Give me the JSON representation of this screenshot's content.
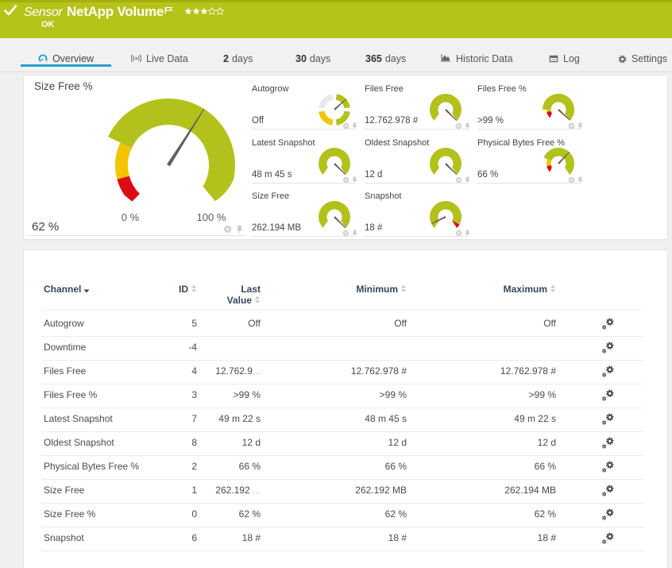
{
  "window": {
    "status_icon": "check",
    "kind": "Sensor",
    "title": "NetApp Volume",
    "status": "OK",
    "rating": {
      "filled": 3,
      "total": 5
    },
    "colors": {
      "header_green": "#b6c318",
      "gauge_green": "#b3c11c",
      "warn_yellow": "#f2c500",
      "error_red": "#dd0b15",
      "accent_blue": "#2aa0cb"
    }
  },
  "tabs": [
    {
      "id": "overview",
      "icon": "gauge-icon",
      "label": "Overview",
      "active": true
    },
    {
      "id": "live-data",
      "icon": "broadcast-icon",
      "label": "Live Data",
      "active": false
    },
    {
      "id": "2-days",
      "num": "2",
      "label": "days",
      "active": false
    },
    {
      "id": "30-days",
      "num": "30",
      "label": "days",
      "active": false
    },
    {
      "id": "365-days",
      "num": "365",
      "label": "days",
      "active": false
    },
    {
      "id": "historic-data",
      "icon": "area-chart-icon",
      "label": "Historic Data",
      "active": false
    },
    {
      "id": "log",
      "icon": "log-icon",
      "label": "Log",
      "active": false
    },
    {
      "id": "settings",
      "icon": "gear-icon",
      "label": "Settings",
      "active": false
    }
  ],
  "overview": {
    "main_gauge": {
      "title": "Size Free %",
      "value": "62 %",
      "min_label": "0 %",
      "max_label": "100 %",
      "needle": 0.62,
      "segments": [
        {
          "from": 0,
          "to": 0.11,
          "color": "red",
          "thin": true
        },
        {
          "from": 0.11,
          "to": 0.26,
          "color": "yellow",
          "thin": true
        },
        {
          "from": 0.26,
          "to": 1,
          "color": "green",
          "thin": false
        }
      ]
    },
    "gauges": [
      {
        "label": "Autogrow",
        "value": "Off",
        "type": "donut",
        "needle_angle": 42,
        "donut_segments": [
          {
            "a0": 8,
            "a1": 82,
            "color": "green"
          },
          {
            "a0": 98,
            "a1": 172,
            "color": "green"
          },
          {
            "a0": 188,
            "a1": 262,
            "color": "yellow"
          },
          {
            "a0": 278,
            "a1": 352,
            "color": "gray"
          }
        ]
      },
      {
        "label": "Files Free",
        "value": "12.762.978 #",
        "type": "gauge",
        "needle": 1,
        "segments": [
          {
            "from": 0,
            "to": 1,
            "color": "green",
            "thin": false
          }
        ]
      },
      {
        "label": "Files Free %",
        "value": ">99 %",
        "type": "gauge",
        "needle": 0.99,
        "segments": [
          {
            "from": 0,
            "to": 0.125,
            "color": "red",
            "thin": true
          },
          {
            "from": 0.125,
            "to": 0.168,
            "color": "yellow",
            "thin": true
          },
          {
            "from": 0.168,
            "to": 1,
            "color": "green",
            "thin": false
          }
        ]
      },
      {
        "label": "Latest Snapshot",
        "value": "48 m 45 s",
        "type": "gauge",
        "needle": 1,
        "segments": [
          {
            "from": 0,
            "to": 1,
            "color": "green",
            "thin": false
          }
        ]
      },
      {
        "label": "Oldest Snapshot",
        "value": "12 d",
        "type": "gauge",
        "needle": 1,
        "segments": [
          {
            "from": 0,
            "to": 1,
            "color": "green",
            "thin": false
          }
        ]
      },
      {
        "label": "Physical Bytes Free %",
        "value": "66 %",
        "type": "gauge",
        "needle": 0.66,
        "segments": [
          {
            "from": 0,
            "to": 0.125,
            "color": "red",
            "thin": true
          },
          {
            "from": 0.125,
            "to": 0.25,
            "color": "yellow",
            "thin": true
          },
          {
            "from": 0.25,
            "to": 1,
            "color": "green",
            "thin": false
          }
        ]
      },
      {
        "label": "Size Free",
        "value": "262.194 MB",
        "type": "gauge",
        "needle": 1,
        "segments": [
          {
            "from": 0,
            "to": 1,
            "color": "green",
            "thin": false
          }
        ]
      },
      {
        "label": "Snapshot",
        "value": "18 #",
        "type": "gauge",
        "needle": 0.072,
        "segments": [
          {
            "from": 0,
            "to": 0.94,
            "color": "green",
            "thin": false
          },
          {
            "from": 0.94,
            "to": 1,
            "color": "red",
            "thin": false
          }
        ]
      }
    ]
  },
  "table": {
    "columns": [
      {
        "id": "channel",
        "label": "Channel",
        "sort": "active"
      },
      {
        "id": "id",
        "label": "ID",
        "sort": "both"
      },
      {
        "id": "last",
        "label": "Last Value",
        "label_line1": "Last",
        "label_line2": "Value",
        "sort": "both"
      },
      {
        "id": "min",
        "label": "Minimum",
        "sort": "both"
      },
      {
        "id": "max",
        "label": "Maximum",
        "sort": "both"
      }
    ],
    "rows": [
      {
        "name": "Autogrow",
        "id": "5",
        "last": "Off",
        "min": "Off",
        "max": "Off"
      },
      {
        "name": "Downtime",
        "id": "-4",
        "last": "",
        "min": "",
        "max": ""
      },
      {
        "name": "Files Free",
        "id": "4",
        "last": "12.762.9",
        "last_trunc": "...",
        "min": "12.762.978 #",
        "max": "12.762.978 #"
      },
      {
        "name": "Files Free %",
        "id": "3",
        "last": ">99 %",
        "min": ">99 %",
        "max": ">99 %"
      },
      {
        "name": "Latest Snapshot",
        "id": "7",
        "last": "49 m 22 s",
        "min": "48 m 45 s",
        "max": "49 m 22 s"
      },
      {
        "name": "Oldest Snapshot",
        "id": "8",
        "last": "12 d",
        "min": "12 d",
        "max": "12 d"
      },
      {
        "name": "Physical Bytes Free %",
        "id": "2",
        "last": "66 %",
        "min": "66 %",
        "max": "66 %"
      },
      {
        "name": "Size Free",
        "id": "1",
        "last": "262.192 ",
        "last_trunc": "...",
        "min": "262.192 MB",
        "max": "262.194 MB"
      },
      {
        "name": "Size Free %",
        "id": "0",
        "last": "62 %",
        "min": "62 %",
        "max": "62 %"
      },
      {
        "name": "Snapshot",
        "id": "6",
        "last": "18 #",
        "min": "18 #",
        "max": "18 #"
      }
    ]
  }
}
